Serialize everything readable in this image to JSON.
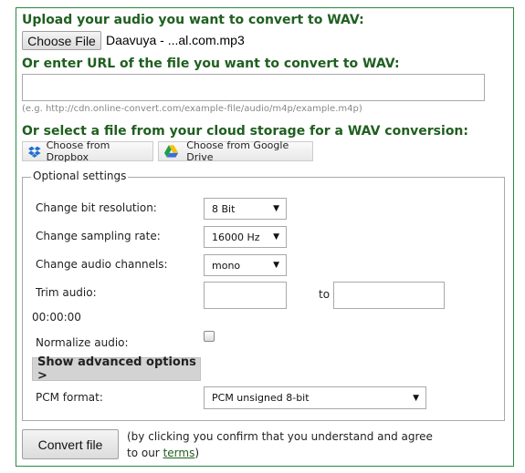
{
  "upload": {
    "heading": "Upload your audio you want to convert to WAV:",
    "choose_file_label": "Choose File",
    "file_name": "Daavuya - ...al.com.mp3"
  },
  "url": {
    "heading": "Or enter URL of the file you want to convert to WAV:",
    "value": "",
    "example": "(e.g. http://cdn.online-convert.com/example-file/audio/m4p/example.m4p)"
  },
  "cloud": {
    "heading": "Or select a file from your cloud storage for a WAV conversion:",
    "dropbox_label": "Choose from Dropbox",
    "gdrive_label": "Choose from Google Drive"
  },
  "settings": {
    "legend": "Optional settings",
    "bit_resolution": {
      "label": "Change bit resolution:",
      "value": "8 Bit"
    },
    "sampling_rate": {
      "label": "Change sampling rate:",
      "value": "16000 Hz"
    },
    "channels": {
      "label": "Change audio channels:",
      "value": "mono"
    },
    "trim": {
      "label": "Trim audio:",
      "to_label": "to",
      "from_value": "",
      "to_value": "",
      "time": "00:00:00"
    },
    "normalize": {
      "label": "Normalize audio:",
      "checked": false
    },
    "advanced_label": "Show advanced options >",
    "pcm": {
      "label": "PCM format:",
      "value": "PCM unsigned 8-bit"
    }
  },
  "convert": {
    "button_label": "Convert file",
    "note_line1": "(by clicking you confirm that you understand and agree",
    "note_prefix": "to our ",
    "terms_label": "terms",
    "note_suffix": ")"
  },
  "colors": {
    "heading": "#1f5f1f",
    "border": "#2a8a3e"
  }
}
